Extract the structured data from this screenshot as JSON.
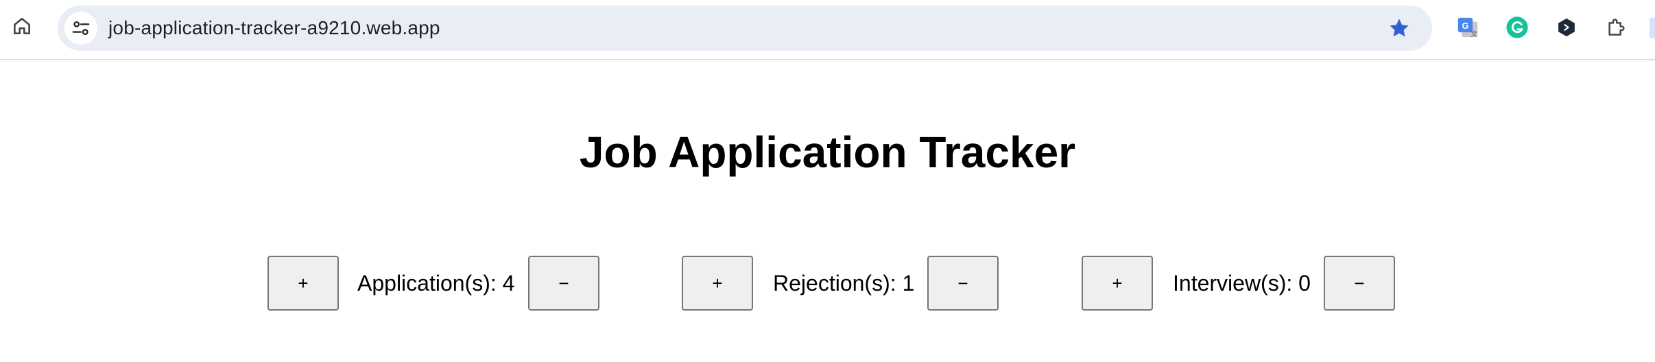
{
  "browser": {
    "url": "job-application-tracker-a9210.web.app",
    "icons": {
      "home": "home-icon",
      "site_info": "tune-icon",
      "bookmark": "star-icon",
      "extensions": [
        "google-translate-icon",
        "grammarly-icon",
        "dev-extension-icon",
        "puzzle-icon"
      ]
    },
    "colors": {
      "star": "#2f62d0",
      "grammarly": "#15c39a",
      "omnibox_bg": "#e9edf6"
    }
  },
  "page": {
    "title": "Job Application Tracker",
    "counters": [
      {
        "label": "Application(s): 4",
        "increment_label": "+",
        "decrement_label": "−"
      },
      {
        "label": "Rejection(s): 1",
        "increment_label": "+",
        "decrement_label": "−"
      },
      {
        "label": "Interview(s): 0",
        "increment_label": "+",
        "decrement_label": "−"
      }
    ]
  }
}
